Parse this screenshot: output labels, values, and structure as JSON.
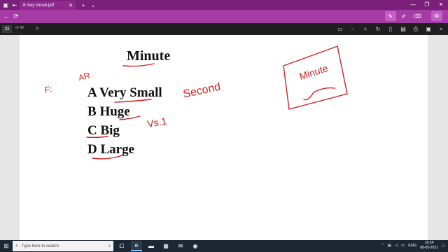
{
  "browser": {
    "tab_title": "8 may vocab.pdf",
    "tab_close": "✕",
    "new_tab": "+",
    "tab_menu": "⌄",
    "window_controls": [
      "—",
      "❐",
      "✕"
    ],
    "back_glyph": "←",
    "reload_glyph": "⟳"
  },
  "pdf_toolbar": {
    "page_number": "33",
    "page_total": "of 42"
  },
  "document": {
    "heading": "Minute",
    "options": [
      {
        "letter": "A",
        "text": "Very Small"
      },
      {
        "letter": "B",
        "text": "Huge"
      },
      {
        "letter": "C",
        "text": "Big"
      },
      {
        "letter": "D",
        "text": "Large"
      }
    ],
    "handwriting": {
      "left_label": "F:",
      "above_a": "AR",
      "second": "Second",
      "vs1": "Vs.1",
      "box_word": "Minute"
    },
    "ink_color": "#d21f1f"
  },
  "taskbar": {
    "search_placeholder": "Type here to search",
    "language": "ENG",
    "time": "16:24",
    "date": "08-05-2021"
  },
  "colors": {
    "tab_bar": "#7a1f7a",
    "address_bar": "#a63ba6",
    "pdf_toolbar": "#1f1f1f",
    "taskbar": "#1c2733"
  }
}
